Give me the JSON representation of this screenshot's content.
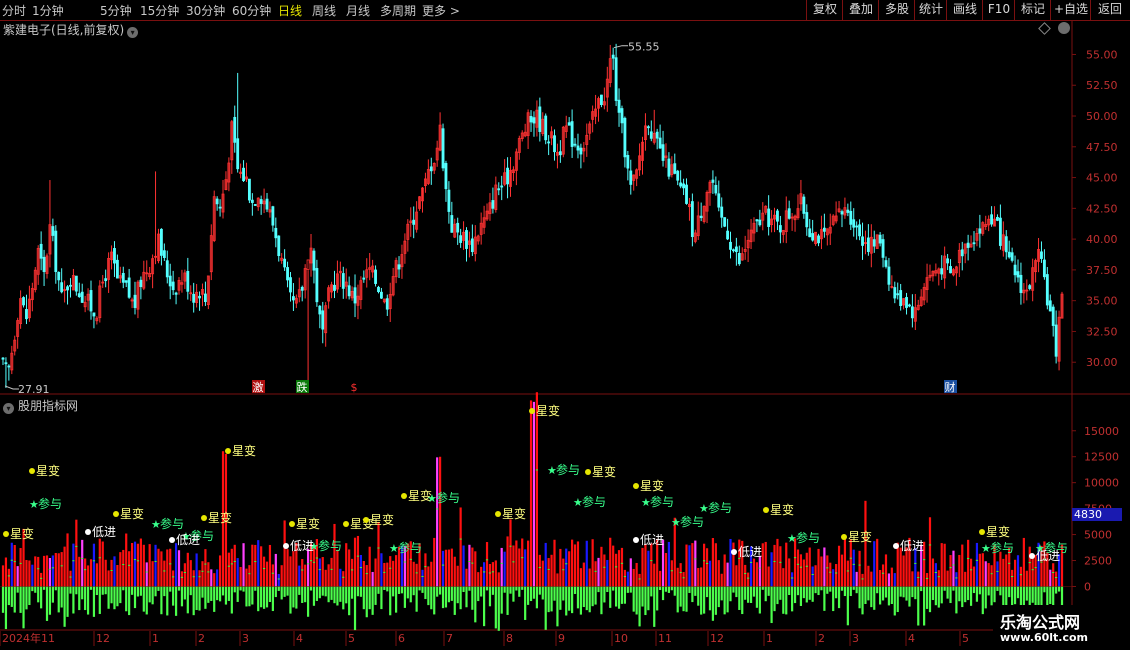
{
  "toolbar": {
    "periods": [
      "分时",
      "1分钟",
      "5分钟",
      "15分钟",
      "30分钟",
      "60分钟",
      "日线",
      "周线",
      "月线",
      "多周期",
      "更多 >"
    ],
    "active_period": "日线",
    "buttons": [
      "复权",
      "叠加",
      "多股",
      "统计",
      "画线",
      "F10",
      "标记",
      "+自选",
      "返回"
    ]
  },
  "main_panel": {
    "title": "紫建电子(日线,前复权)",
    "high_label": "55.55",
    "low_label": "27.91",
    "y_ticks": [
      "55.00",
      "52.50",
      "50.00",
      "47.50",
      "45.00",
      "42.50",
      "40.00",
      "37.50",
      "35.00",
      "32.50",
      "30.00"
    ],
    "event_marks": [
      {
        "text": "激",
        "color": "#ffffff",
        "bg": "#b01010"
      },
      {
        "text": "跌",
        "color": "#ffffff",
        "bg": "#0a7a0a"
      },
      {
        "text": "$",
        "color": "#ff3030",
        "bg": ""
      },
      {
        "text": "财",
        "color": "#ffffff",
        "bg": "#1a4fa0"
      }
    ]
  },
  "indicator_panel": {
    "title": "股朋指标网",
    "y_ticks": [
      "15000",
      "12500",
      "10000",
      "7500",
      "5000",
      "2500",
      "0"
    ],
    "current_value": "4830",
    "signal_labels": [
      "星变",
      "参与",
      "低进"
    ]
  },
  "x_axis": {
    "labels": [
      "2024年11",
      "12",
      "1",
      "2",
      "3",
      "4",
      "5",
      "6",
      "7",
      "8",
      "9",
      "10",
      "11",
      "12",
      "1",
      "2",
      "3",
      "4",
      "5"
    ]
  },
  "watermark": {
    "line1": "乐淘公式网",
    "line2": "www.60lt.com"
  },
  "colors": {
    "up": "#ff3232",
    "down": "#54ffff",
    "accent": "#e6e600",
    "border": "#7a1010",
    "vol_up": "#ff1010",
    "vol_down": "#4cff4c"
  },
  "chart_data": [
    {
      "type": "candlestick",
      "title": "紫建电子(日线,前复权)",
      "x": [
        "2024-11",
        "2024-12",
        "2025-01",
        "2025-02",
        "2025-03",
        "2025-04",
        "2025-05",
        "2025-06",
        "2025-07",
        "2025-08",
        "2025-09",
        "2025-10",
        "2025-11",
        "2025-12",
        "2026-01",
        "2026-02",
        "2026-03",
        "2026-04",
        "2026-05"
      ],
      "monthly_close": [
        33.5,
        36.0,
        36.5,
        37.0,
        45.0,
        35.0,
        37.0,
        37.5,
        46.0,
        41.0,
        50.0,
        48.0,
        44.0,
        38.5,
        41.0,
        40.5,
        39.0,
        35.5,
        36.0
      ],
      "ylim": [
        27.5,
        56.5
      ],
      "max": 55.55,
      "min": 27.91
    },
    {
      "type": "bar",
      "title": "股朋指标网",
      "ylim": [
        -4000,
        17000
      ],
      "last_value": 4830
    }
  ]
}
